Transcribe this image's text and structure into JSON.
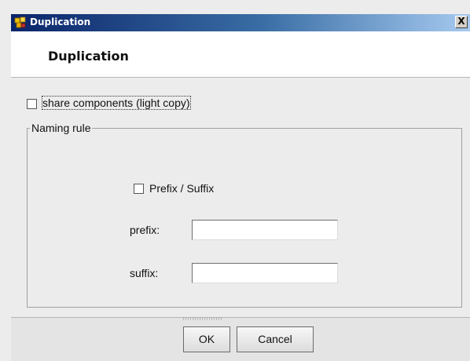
{
  "window": {
    "title": "Duplication",
    "close_glyph": "X"
  },
  "header": {
    "title": "Duplication"
  },
  "options": {
    "share_components_label": "share components (light copy)",
    "share_components_checked": false
  },
  "naming_rule": {
    "legend": "Naming rule",
    "prefix_suffix_label": "Prefix / Suffix",
    "prefix_suffix_checked": false,
    "prefix_label": "prefix:",
    "prefix_value": "",
    "suffix_label": "suffix:",
    "suffix_value": ""
  },
  "buttons": {
    "ok_label": "OK",
    "cancel_label": "Cancel"
  },
  "icons": {
    "app_icon": "app-logo-icon",
    "close_icon": "close-icon"
  }
}
